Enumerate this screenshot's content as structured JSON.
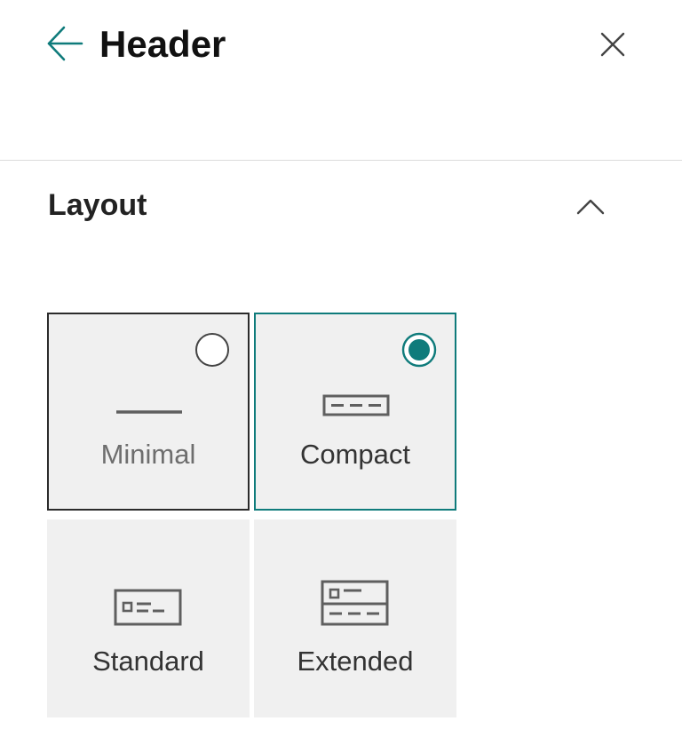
{
  "panel": {
    "title": "Header"
  },
  "icons": {
    "back": "back-arrow-icon",
    "close": "close-icon",
    "collapse": "chevron-up-icon"
  },
  "section": {
    "title": "Layout",
    "expanded": true
  },
  "layout_options": [
    {
      "label": "Minimal",
      "selected": false,
      "icon": "minimal-layout-icon"
    },
    {
      "label": "Compact",
      "selected": true,
      "icon": "compact-layout-icon"
    },
    {
      "label": "Standard",
      "selected": false,
      "icon": "standard-layout-icon"
    },
    {
      "label": "Extended",
      "selected": false,
      "icon": "extended-layout-icon"
    }
  ],
  "colors": {
    "accent": "#0f7b7b",
    "tile_background": "#f0f0f0",
    "focus_border": "#2b2b2b",
    "divider": "#dcdcdc",
    "icon": "#5f5f5f"
  }
}
